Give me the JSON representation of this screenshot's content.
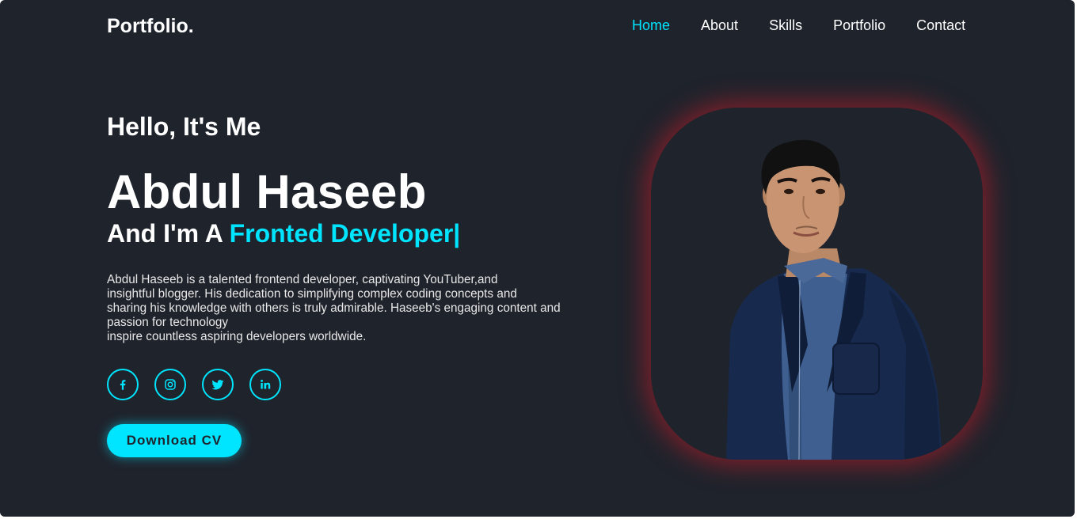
{
  "header": {
    "logo": "Portfolio.",
    "nav": [
      {
        "label": "Home",
        "active": true
      },
      {
        "label": "About"
      },
      {
        "label": "Skills"
      },
      {
        "label": "Portfolio"
      },
      {
        "label": "Contact"
      }
    ]
  },
  "hero": {
    "greeting": "Hello, It's Me",
    "name": "Abdul Haseeb",
    "role_prefix": "And I'm A ",
    "role_highlight": "Fronted Developer|",
    "bio_lines": [
      "Abdul Haseeb is a talented frontend developer, captivating YouTuber,and",
      "insightful blogger. His dedication to simplifying complex coding concepts and",
      "sharing his knowledge with others is truly admirable. Haseeb's engaging content and",
      "passion for technology",
      "inspire countless aspiring developers worldwide."
    ],
    "socials": [
      "facebook-icon",
      "instagram-icon",
      "twitter-icon",
      "linkedin-icon"
    ],
    "cta_label": "Download CV"
  },
  "colors": {
    "accent": "#00e5ff",
    "background": "#1f232c",
    "glow": "#c81e28"
  }
}
